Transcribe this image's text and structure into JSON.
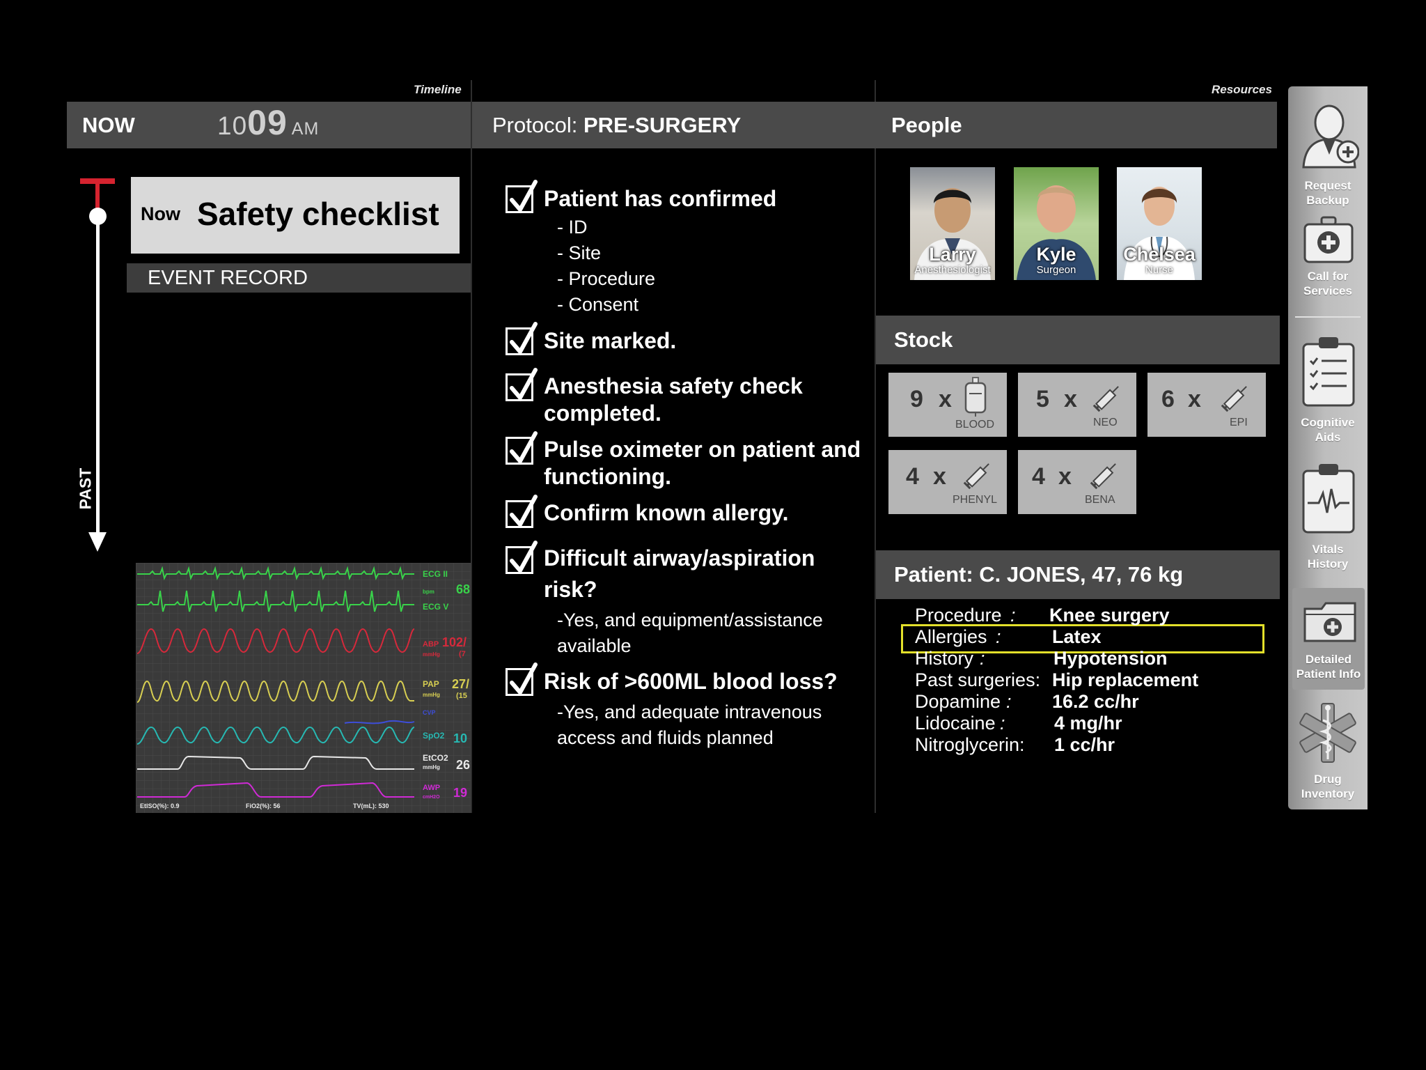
{
  "timeline": {
    "caption": "Timeline",
    "now_label": "NOW",
    "clock_hour": "10",
    "clock_min": "09",
    "clock_ampm": "AM",
    "event": {
      "now_tag": "Now",
      "title": "Safety checklist"
    },
    "event_record_label": "EVENT RECORD",
    "past_label": "PAST"
  },
  "monitor": {
    "labels": {
      "ecg2": "ECG II",
      "bpm": "bpm",
      "ecgv": "ECG V",
      "hr": "68",
      "abp": "ABP",
      "abp_val": "102/",
      "mmhg1": "mmHg",
      "abp_sub": "(7",
      "pap": "PAP",
      "pap_val": "27/",
      "mmhg2": "mmHg",
      "pap_sub": "(15",
      "cvp": "CVP",
      "spo2": "SpO2",
      "spo2_val": "10",
      "etco2": "EtCO2",
      "mmhg3": "mmHg",
      "etco2_val": "26",
      "awp": "AWP",
      "awp_unit": "cmH2O",
      "awp_val": "19",
      "footer_1": "EtISO(%): 0.9",
      "footer_2": "FiO2(%): 56",
      "footer_3": "TV(mL): 530"
    },
    "colors": {
      "ecg": "#39d24a",
      "abp": "#d6293b",
      "pap": "#d8cf52",
      "cvp": "#3d4dd8",
      "spo2": "#27b9b3",
      "etco2": "#e8e8e8",
      "awp": "#d02ad6"
    }
  },
  "protocol": {
    "header_prefix": "Protocol: ",
    "header_name": "PRE-SURGERY",
    "items": [
      {
        "title": "Patient has confirmed",
        "subs": [
          "- ID",
          "- Site",
          "- Procedure",
          "- Consent"
        ]
      },
      {
        "title": "Site marked."
      },
      {
        "title_line1": "Anesthesia safety check",
        "title_line2": "completed."
      },
      {
        "title_line1": "Pulse oximeter on patient and",
        "title_line2": "functioning."
      },
      {
        "title": "Confirm known allergy."
      },
      {
        "title_line1": "Difficult airway/aspiration",
        "title_line2": "risk?",
        "subs": [
          "-Yes, and equipment/assistance",
          "available"
        ]
      },
      {
        "title": "Risk of >600ML blood loss?",
        "subs": [
          "-Yes, and adequate intravenous",
          "access and fluids planned"
        ]
      }
    ]
  },
  "resources": {
    "caption": "Resources",
    "people_header": "People",
    "people": [
      {
        "name": "Larry",
        "role": "Anesthesiologist"
      },
      {
        "name": "Kyle",
        "role": "Surgeon"
      },
      {
        "name": "Chelsea",
        "role": "Nurse"
      }
    ],
    "stock_header": "Stock",
    "stock": [
      {
        "count": "9",
        "x": "x",
        "name": "BLOOD",
        "icon": "blood-bag-icon"
      },
      {
        "count": "5",
        "x": "x",
        "name": "NEO",
        "icon": "syringe-icon"
      },
      {
        "count": "6",
        "x": "x",
        "name": "EPI",
        "icon": "syringe-icon"
      },
      {
        "count": "4",
        "x": "x",
        "name": "PHENYL",
        "icon": "syringe-icon"
      },
      {
        "count": "4",
        "x": "x",
        "name": "BENA",
        "icon": "syringe-icon"
      }
    ],
    "patient_header": "Patient: C. JONES, 47, 76 kg",
    "patient_info": [
      {
        "label": "Procedure",
        "value": "Knee surgery"
      },
      {
        "label": "Allergies",
        "value": "Latex"
      },
      {
        "label": "History",
        "value": "Hypotension"
      },
      {
        "label": "Past surgeries:",
        "value": "Hip replacement"
      },
      {
        "label": "Dopamine",
        "value": "16.2 cc/hr"
      },
      {
        "label": "Lidocaine",
        "value": "4 mg/hr"
      },
      {
        "label": "Nitroglycerin:",
        "value": "1 cc/hr"
      }
    ],
    "highlight_color": "#e3e02a"
  },
  "sidebar": {
    "items": [
      {
        "line1": "Request",
        "line2": "Backup",
        "icon": "request-backup-icon"
      },
      {
        "line1": "Call for",
        "line2": "Services",
        "icon": "medical-kit-icon"
      },
      {
        "line1": "Cognitive",
        "line2": "Aids",
        "icon": "clipboard-checklist-icon"
      },
      {
        "line1": "Vitals",
        "line2": "History",
        "icon": "clipboard-vitals-icon"
      },
      {
        "line1": "Detailed",
        "line2": "Patient Info",
        "icon": "patient-folder-icon"
      },
      {
        "line1": "Drug",
        "line2": "Inventory",
        "icon": "caduceus-icon"
      }
    ]
  }
}
